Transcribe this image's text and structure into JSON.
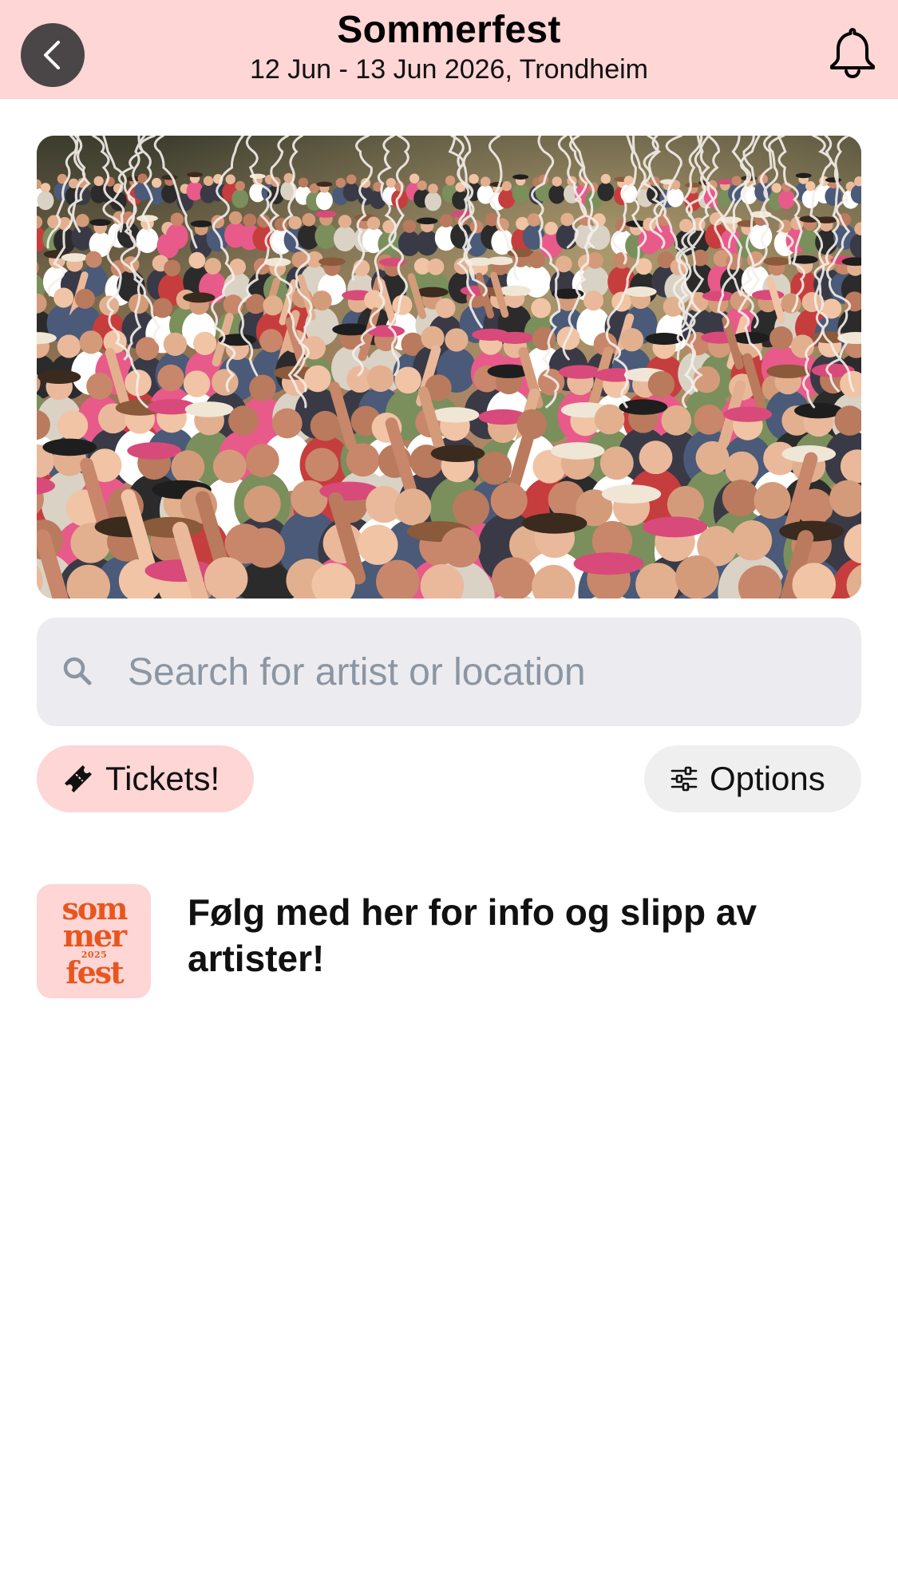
{
  "header": {
    "title": "Sommerfest",
    "subtitle": "12 Jun - 13 Jun 2026, Trondheim",
    "back_icon": "chevron-left-icon",
    "notification_icon": "bell-icon",
    "background_color": "#fdd6d5"
  },
  "hero": {
    "image": "festival-crowd-photo"
  },
  "search": {
    "placeholder": "Search for artist or location",
    "value": "",
    "icon": "search-icon"
  },
  "actions": {
    "tickets_label": "Tickets!",
    "tickets_icon": "ticket-icon",
    "options_label": "Options",
    "options_icon": "sliders-icon"
  },
  "news": {
    "items": [
      {
        "logo_lines": [
          "som",
          "mer",
          "2025",
          "fest"
        ],
        "logo_color": "#e8561e",
        "text": "Følg med her for info og slipp av artister!"
      }
    ]
  }
}
